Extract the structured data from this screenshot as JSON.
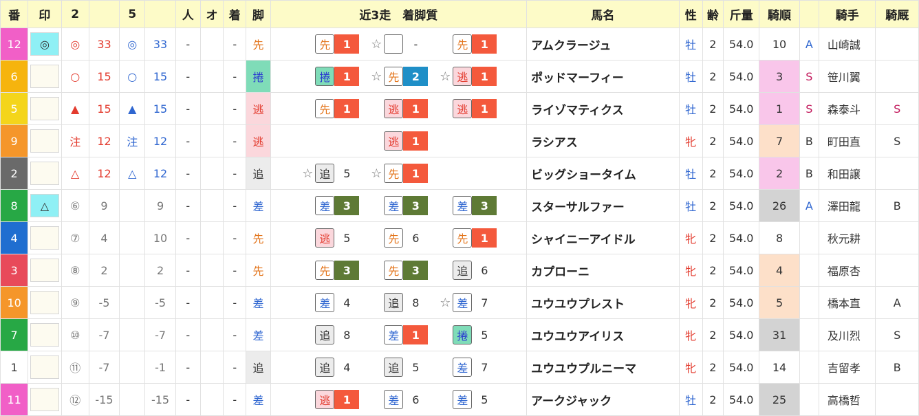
{
  "colors": {
    "header_bg": "#fdfbc8",
    "style_先": {
      "bg": "#ffffff",
      "fg": "#e3751c",
      "badge_bg": "#ffffff"
    },
    "style_捲": {
      "bg": "#7fdcb8",
      "fg": "#2a3ad0",
      "badge_bg": "#7fdcb8"
    },
    "style_逃": {
      "bg": "#fbd7dc",
      "fg": "#e33b2e",
      "badge_bg": "#fbd7dc"
    },
    "style_追": {
      "bg": "#ececec",
      "fg": "#333333",
      "badge_bg": "#ececec"
    },
    "style_差": {
      "bg": "#ffffff",
      "fg": "#2f66d0",
      "badge_bg": "#ffffff"
    },
    "pos_1": "#f4593c",
    "pos_2": "#1f8fc7",
    "pos_3": "#5e7a35",
    "pop_1_3": "#f9c6ea",
    "pop_4_7": "#fde0c9",
    "pop_25plus": "#d3d3d3"
  },
  "headers": [
    "番",
    "印",
    "2",
    "",
    "5",
    "",
    "人",
    "オ",
    "着",
    "脚",
    "近3走　着脚質",
    "馬名",
    "性",
    "齢",
    "斤量",
    "騎順",
    "",
    "騎手",
    "騎厩"
  ],
  "rows": [
    {
      "ban": "12",
      "ban_bg": "#f15fc7",
      "mark": "◎",
      "mark_bg": "#8ff0f5",
      "m2": "◎",
      "v2": "33",
      "m5": "◎",
      "v5": "33",
      "c2": "red",
      "c5": "blue",
      "ninki": "-",
      "odds": "",
      "chaku": "-",
      "ashi": "先",
      "races": [
        {
          "star": "",
          "style": "先",
          "pos": "1"
        },
        {
          "star": "☆",
          "style": "",
          "pos": "-"
        },
        {
          "star": "",
          "style": "先",
          "pos": "1"
        }
      ],
      "horse": "アムクラージュ",
      "sex": "牡",
      "age": "2",
      "kin": "54.0",
      "kijun": "10",
      "kijun_bg": "",
      "rank": "A",
      "rank_color": "#2f66d0",
      "jockey": "山崎誠",
      "kikyu": ""
    },
    {
      "ban": "6",
      "ban_bg": "#f6b40e",
      "mark": "",
      "mark_bg": "",
      "m2": "○",
      "v2": "15",
      "m5": "○",
      "v5": "15",
      "c2": "red",
      "c5": "blue",
      "ninki": "-",
      "odds": "",
      "chaku": "-",
      "ashi": "捲",
      "races": [
        {
          "star": "",
          "style": "捲",
          "pos": "1"
        },
        {
          "star": "☆",
          "style": "先",
          "pos": "2"
        },
        {
          "star": "☆",
          "style": "逃",
          "pos": "1"
        }
      ],
      "horse": "ポッドマーフィー",
      "sex": "牡",
      "age": "2",
      "kin": "54.0",
      "kijun": "3",
      "kijun_bg": "#f9c6ea",
      "rank": "S",
      "rank_color": "#c2185b",
      "jockey": "笹川翼",
      "kikyu": ""
    },
    {
      "ban": "5",
      "ban_bg": "#f4d51b",
      "mark": "",
      "mark_bg": "",
      "m2": "▲",
      "v2": "15",
      "m5": "▲",
      "v5": "15",
      "c2": "red",
      "c5": "blue",
      "ninki": "-",
      "odds": "",
      "chaku": "-",
      "ashi": "逃",
      "races": [
        {
          "star": "",
          "style": "先",
          "pos": "1"
        },
        {
          "star": "",
          "style": "逃",
          "pos": "1"
        },
        {
          "star": "",
          "style": "逃",
          "pos": "1"
        }
      ],
      "horse": "ライゾマティクス",
      "sex": "牡",
      "age": "2",
      "kin": "54.0",
      "kijun": "1",
      "kijun_bg": "#f9c6ea",
      "rank": "S",
      "rank_color": "#c2185b",
      "jockey": "森泰斗",
      "kikyu": "S",
      "kikyu_color": "#c2185b"
    },
    {
      "ban": "9",
      "ban_bg": "#f5962a",
      "mark": "",
      "mark_bg": "",
      "m2": "注",
      "v2": "12",
      "m5": "注",
      "v5": "12",
      "c2": "red",
      "c5": "blue",
      "ninki": "-",
      "odds": "",
      "chaku": "-",
      "ashi": "逃",
      "races": [
        {
          "star": "",
          "style": "",
          "pos": ""
        },
        {
          "star": "",
          "style": "逃",
          "pos": "1"
        },
        {
          "star": "",
          "style": "",
          "pos": ""
        }
      ],
      "horse": "ラシアス",
      "sex": "牝",
      "age": "2",
      "kin": "54.0",
      "kijun": "7",
      "kijun_bg": "#fde0c9",
      "rank": "B",
      "rank_color": "#333333",
      "jockey": "町田直",
      "kikyu": "S",
      "kikyu_color": "#333333"
    },
    {
      "ban": "2",
      "ban_bg": "#6a6a6a",
      "mark": "",
      "mark_bg": "",
      "m2": "△",
      "v2": "12",
      "m5": "△",
      "v5": "12",
      "c2": "red",
      "c5": "blue",
      "ninki": "-",
      "odds": "",
      "chaku": "-",
      "ashi": "追",
      "races": [
        {
          "star": "☆",
          "style": "追",
          "pos": "5"
        },
        {
          "star": "☆",
          "style": "先",
          "pos": "1"
        },
        {
          "star": "",
          "style": "",
          "pos": ""
        }
      ],
      "horse": "ビッグショータイム",
      "sex": "牡",
      "age": "2",
      "kin": "54.0",
      "kijun": "2",
      "kijun_bg": "#f9c6ea",
      "rank": "B",
      "rank_color": "#333333",
      "jockey": "和田譲",
      "kikyu": ""
    },
    {
      "ban": "8",
      "ban_bg": "#27a845",
      "mark": "△",
      "mark_bg": "#8ff0f5",
      "m2": "⑥",
      "v2": "9",
      "m5": "",
      "v5": "9",
      "c2": "gray",
      "c5": "gray",
      "ninki": "-",
      "odds": "",
      "chaku": "-",
      "ashi": "差",
      "races": [
        {
          "star": "",
          "style": "差",
          "pos": "3"
        },
        {
          "star": "",
          "style": "差",
          "pos": "3"
        },
        {
          "star": "",
          "style": "差",
          "pos": "3"
        }
      ],
      "horse": "スターサルファー",
      "sex": "牡",
      "age": "2",
      "kin": "54.0",
      "kijun": "26",
      "kijun_bg": "#d3d3d3",
      "rank": "A",
      "rank_color": "#2f66d0",
      "jockey": "澤田龍",
      "kikyu": "B",
      "kikyu_color": "#333333"
    },
    {
      "ban": "4",
      "ban_bg": "#1f6ed0",
      "mark": "",
      "mark_bg": "",
      "m2": "⑦",
      "v2": "4",
      "m5": "",
      "v5": "10",
      "c2": "gray",
      "c5": "gray",
      "ninki": "-",
      "odds": "",
      "chaku": "-",
      "ashi": "先",
      "races": [
        {
          "star": "",
          "style": "逃",
          "pos": "5"
        },
        {
          "star": "",
          "style": "先",
          "pos": "6"
        },
        {
          "star": "",
          "style": "先",
          "pos": "1"
        }
      ],
      "horse": "シャイニーアイドル",
      "sex": "牝",
      "age": "2",
      "kin": "54.0",
      "kijun": "8",
      "kijun_bg": "",
      "rank": "",
      "rank_color": "#333333",
      "jockey": "秋元耕",
      "kikyu": ""
    },
    {
      "ban": "3",
      "ban_bg": "#e84a5a",
      "mark": "",
      "mark_bg": "",
      "m2": "⑧",
      "v2": "2",
      "m5": "",
      "v5": "2",
      "c2": "gray",
      "c5": "gray",
      "ninki": "-",
      "odds": "",
      "chaku": "-",
      "ashi": "先",
      "races": [
        {
          "star": "",
          "style": "先",
          "pos": "3"
        },
        {
          "star": "",
          "style": "先",
          "pos": "3"
        },
        {
          "star": "",
          "style": "追",
          "pos": "6"
        }
      ],
      "horse": "カプローニ",
      "sex": "牝",
      "age": "2",
      "kin": "54.0",
      "kijun": "4",
      "kijun_bg": "#fde0c9",
      "rank": "",
      "rank_color": "#333333",
      "jockey": "福原杏",
      "kikyu": ""
    },
    {
      "ban": "10",
      "ban_bg": "#f5962a",
      "mark": "",
      "mark_bg": "",
      "m2": "⑨",
      "v2": "-5",
      "m5": "",
      "v5": "-5",
      "c2": "gray",
      "c5": "gray",
      "ninki": "-",
      "odds": "",
      "chaku": "-",
      "ashi": "差",
      "races": [
        {
          "star": "",
          "style": "差",
          "pos": "4"
        },
        {
          "star": "",
          "style": "追",
          "pos": "8"
        },
        {
          "star": "☆",
          "style": "差",
          "pos": "7"
        }
      ],
      "horse": "ユウユウプレスト",
      "sex": "牝",
      "age": "2",
      "kin": "54.0",
      "kijun": "5",
      "kijun_bg": "#fde0c9",
      "rank": "",
      "rank_color": "#333333",
      "jockey": "橋本直",
      "kikyu": "A",
      "kikyu_color": "#333333"
    },
    {
      "ban": "7",
      "ban_bg": "#27a845",
      "mark": "",
      "mark_bg": "",
      "m2": "⑩",
      "v2": "-7",
      "m5": "",
      "v5": "-7",
      "c2": "gray",
      "c5": "gray",
      "ninki": "-",
      "odds": "",
      "chaku": "-",
      "ashi": "差",
      "races": [
        {
          "star": "",
          "style": "追",
          "pos": "8"
        },
        {
          "star": "",
          "style": "差",
          "pos": "1"
        },
        {
          "star": "",
          "style": "捲",
          "pos": "5"
        }
      ],
      "horse": "ユウユウアイリス",
      "sex": "牝",
      "age": "2",
      "kin": "54.0",
      "kijun": "31",
      "kijun_bg": "#d3d3d3",
      "rank": "",
      "rank_color": "#333333",
      "jockey": "及川烈",
      "kikyu": "S",
      "kikyu_color": "#333333"
    },
    {
      "ban": "1",
      "ban_bg": "#ffffff",
      "ban_fg": "#333333",
      "mark": "",
      "mark_bg": "",
      "m2": "⑪",
      "v2": "-7",
      "m5": "",
      "v5": "-1",
      "c2": "gray",
      "c5": "gray",
      "ninki": "-",
      "odds": "",
      "chaku": "-",
      "ashi": "追",
      "races": [
        {
          "star": "",
          "style": "追",
          "pos": "4"
        },
        {
          "star": "",
          "style": "追",
          "pos": "5"
        },
        {
          "star": "",
          "style": "差",
          "pos": "7"
        }
      ],
      "horse": "ユウユウプルニーマ",
      "sex": "牝",
      "age": "2",
      "kin": "54.0",
      "kijun": "14",
      "kijun_bg": "",
      "rank": "",
      "rank_color": "#333333",
      "jockey": "吉留孝",
      "kikyu": "B",
      "kikyu_color": "#333333"
    },
    {
      "ban": "11",
      "ban_bg": "#f15fc7",
      "mark": "",
      "mark_bg": "",
      "m2": "⑫",
      "v2": "-15",
      "m5": "",
      "v5": "-15",
      "c2": "gray",
      "c5": "gray",
      "ninki": "-",
      "odds": "",
      "chaku": "-",
      "ashi": "差",
      "races": [
        {
          "star": "",
          "style": "逃",
          "pos": "1"
        },
        {
          "star": "",
          "style": "差",
          "pos": "6"
        },
        {
          "star": "",
          "style": "差",
          "pos": "5"
        }
      ],
      "horse": "アークジャック",
      "sex": "牡",
      "age": "2",
      "kin": "54.0",
      "kijun": "25",
      "kijun_bg": "#d3d3d3",
      "rank": "",
      "rank_color": "#333333",
      "jockey": "高橋哲",
      "kikyu": ""
    }
  ]
}
